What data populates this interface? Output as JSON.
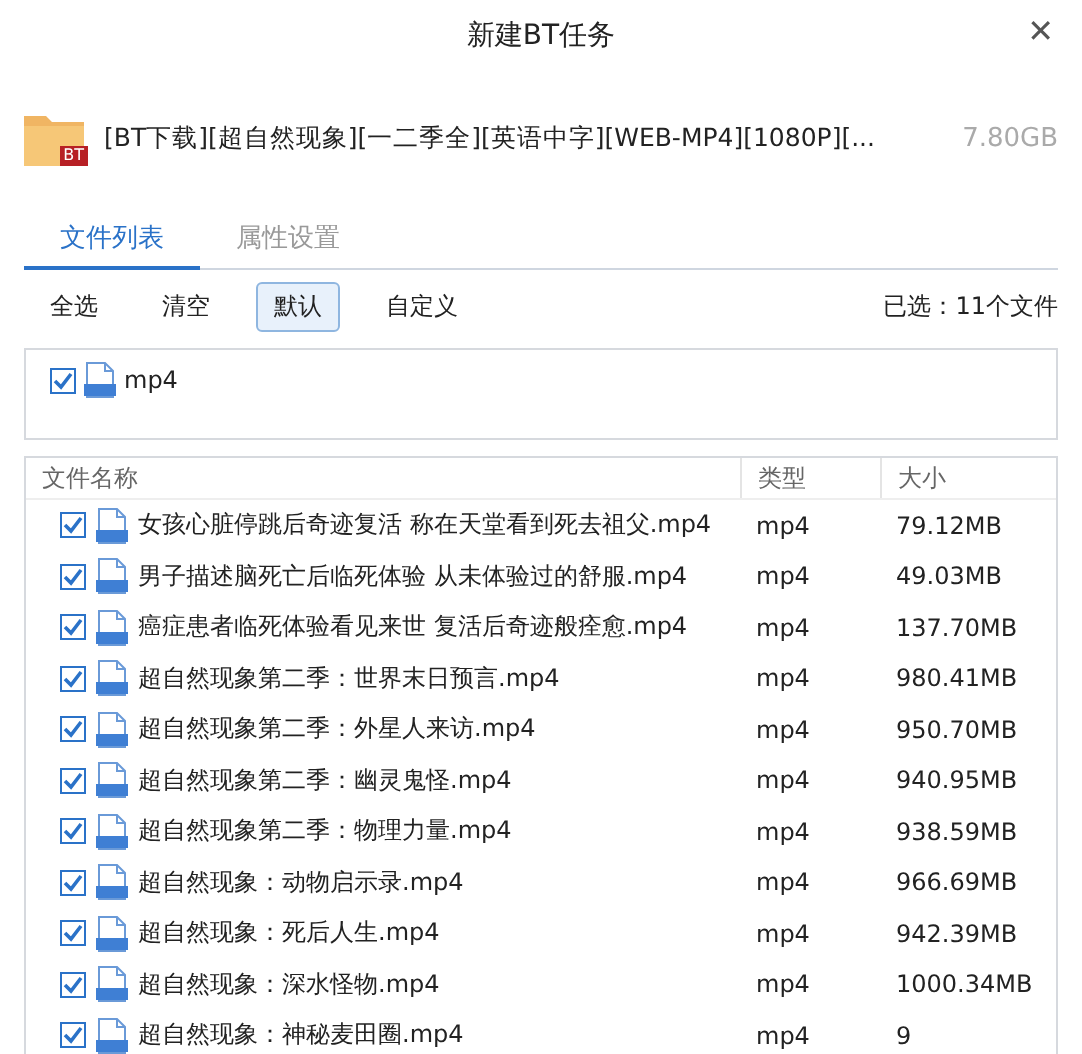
{
  "window": {
    "title": "新建BT任务",
    "close": "✕"
  },
  "torrent": {
    "badge": "BT",
    "name": "[BT下载][超自然现象][一二季全][英语中字][WEB-MP4][1080P][...",
    "size": "7.80GB"
  },
  "tabs": [
    {
      "label": "文件列表",
      "selected": true
    },
    {
      "label": "属性设置",
      "selected": false
    }
  ],
  "toolbar": {
    "buttons": [
      {
        "label": "全选",
        "selected": false
      },
      {
        "label": "清空",
        "selected": false
      },
      {
        "label": "默认",
        "selected": true
      },
      {
        "label": "自定义",
        "selected": false
      }
    ],
    "summary": "已选：11个文件"
  },
  "filters": [
    {
      "label": "mp4",
      "checked": true
    }
  ],
  "table": {
    "columns": [
      "文件名称",
      "类型",
      "大小"
    ],
    "rows": [
      {
        "name": "女孩心脏停跳后奇迹复活 称在天堂看到死去祖父.mp4",
        "type": "mp4",
        "size": "79.12MB",
        "checked": true
      },
      {
        "name": "男子描述脑死亡后临死体验 从未体验过的舒服.mp4",
        "type": "mp4",
        "size": "49.03MB",
        "checked": true
      },
      {
        "name": "癌症患者临死体验看见来世 复活后奇迹般痊愈.mp4",
        "type": "mp4",
        "size": "137.70MB",
        "checked": true
      },
      {
        "name": "超自然现象第二季：世界末日预言.mp4",
        "type": "mp4",
        "size": "980.41MB",
        "checked": true
      },
      {
        "name": "超自然现象第二季：外星人来访.mp4",
        "type": "mp4",
        "size": "950.70MB",
        "checked": true
      },
      {
        "name": "超自然现象第二季：幽灵鬼怪.mp4",
        "type": "mp4",
        "size": "940.95MB",
        "checked": true
      },
      {
        "name": "超自然现象第二季：物理力量.mp4",
        "type": "mp4",
        "size": "938.59MB",
        "checked": true
      },
      {
        "name": "超自然现象：动物启示录.mp4",
        "type": "mp4",
        "size": "966.69MB",
        "checked": true
      },
      {
        "name": "超自然现象：死后人生.mp4",
        "type": "mp4",
        "size": "942.39MB",
        "checked": true
      },
      {
        "name": "超自然现象：深水怪物.mp4",
        "type": "mp4",
        "size": "1000.34MB",
        "checked": true
      },
      {
        "name": "超自然现象：神秘麦田圈.mp4",
        "type": "mp4",
        "size": "9",
        "checked": true
      }
    ]
  }
}
